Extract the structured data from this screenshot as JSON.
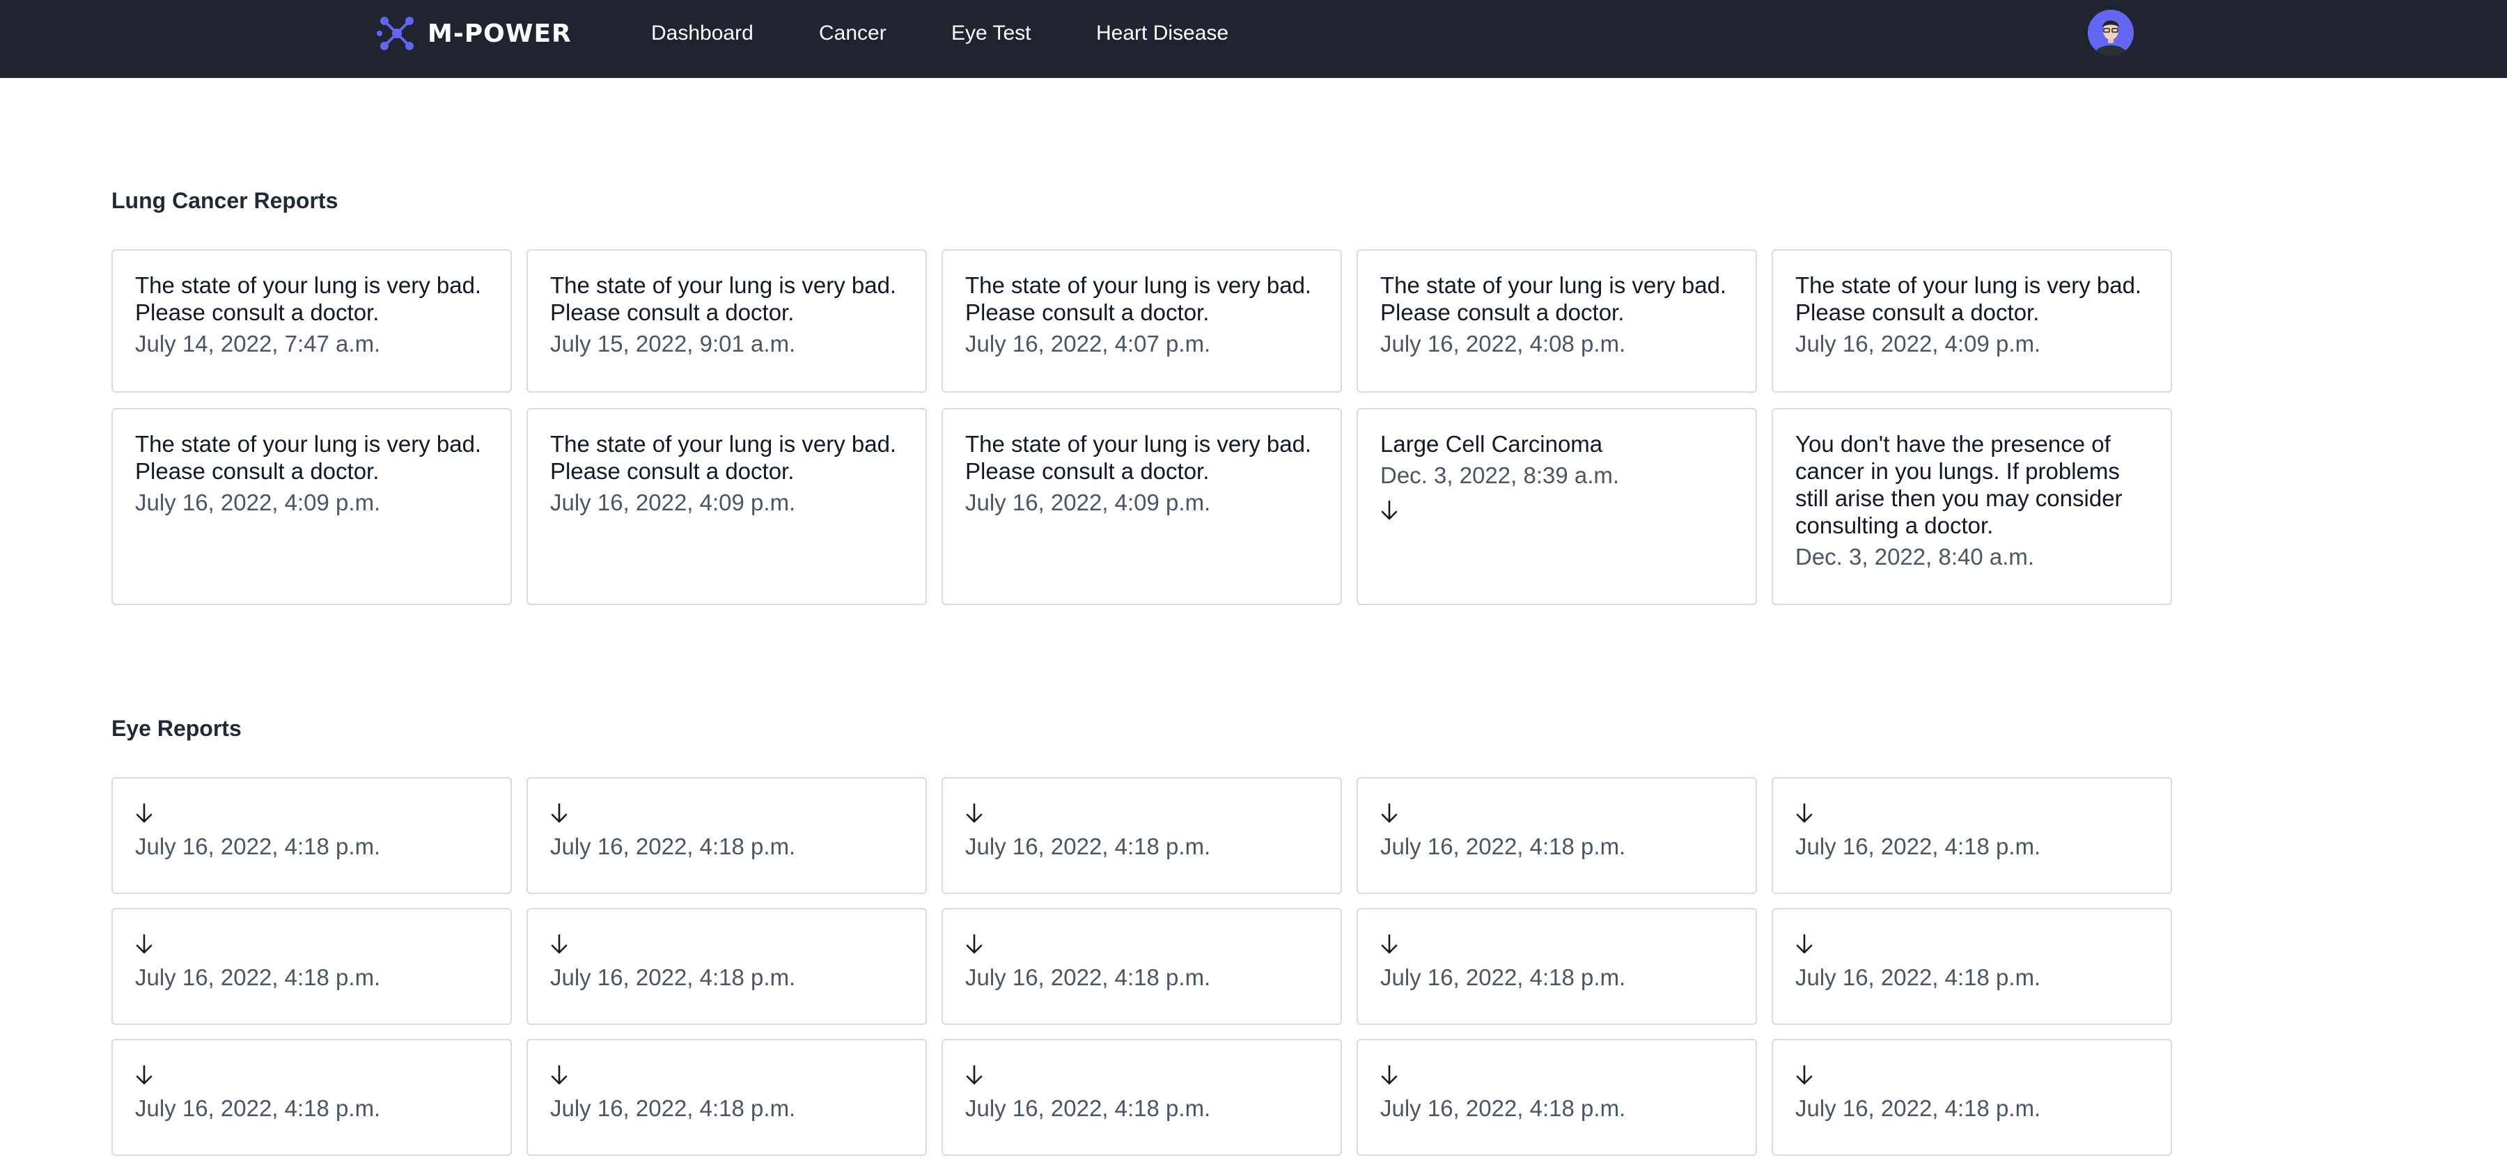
{
  "brand": {
    "name": "M-POWER",
    "logo_icon": "molecule-logo-icon",
    "accent_color": "#6366f1"
  },
  "nav": {
    "items": [
      {
        "label": "Dashboard"
      },
      {
        "label": "Cancer"
      },
      {
        "label": "Eye Test"
      },
      {
        "label": "Heart Disease"
      }
    ],
    "background_color": "#1f2430"
  },
  "user": {
    "avatar_icon": "user-avatar-icon"
  },
  "lung": {
    "title": "Lung Cancer Reports",
    "reports": [
      {
        "result": "The state of your lung is very bad. Please consult a doctor.",
        "date": "July 14, 2022, 7:47 a.m."
      },
      {
        "result": "The state of your lung is very bad. Please consult a doctor.",
        "date": "July 15, 2022, 9:01 a.m."
      },
      {
        "result": "The state of your lung is very bad. Please consult a doctor.",
        "date": "July 16, 2022, 4:07 p.m."
      },
      {
        "result": "The state of your lung is very bad. Please consult a doctor.",
        "date": "July 16, 2022, 4:08 p.m."
      },
      {
        "result": "The state of your lung is very bad. Please consult a doctor.",
        "date": "July 16, 2022, 4:09 p.m."
      },
      {
        "result": "The state of your lung is very bad. Please consult a doctor.",
        "date": "July 16, 2022, 4:09 p.m."
      },
      {
        "result": "The state of your lung is very bad. Please consult a doctor.",
        "date": "July 16, 2022, 4:09 p.m."
      },
      {
        "result": "The state of your lung is very bad. Please consult a doctor.",
        "date": "July 16, 2022, 4:09 p.m."
      },
      {
        "result": "Large Cell Carcinoma",
        "date": "Dec. 3, 2022, 8:39 a.m.",
        "download_icon": "arrow-down-icon"
      },
      {
        "result": "You don't have the presence of cancer in you lungs. If problems still arise then you may consider consulting a doctor.",
        "date": "Dec. 3, 2022, 8:40 a.m."
      }
    ]
  },
  "eye": {
    "title": "Eye Reports",
    "download_icon": "arrow-down-icon",
    "reports": [
      {
        "date": "July 16, 2022, 4:18 p.m."
      },
      {
        "date": "July 16, 2022, 4:18 p.m."
      },
      {
        "date": "July 16, 2022, 4:18 p.m."
      },
      {
        "date": "July 16, 2022, 4:18 p.m."
      },
      {
        "date": "July 16, 2022, 4:18 p.m."
      },
      {
        "date": "July 16, 2022, 4:18 p.m."
      },
      {
        "date": "July 16, 2022, 4:18 p.m."
      },
      {
        "date": "July 16, 2022, 4:18 p.m."
      },
      {
        "date": "July 16, 2022, 4:18 p.m."
      },
      {
        "date": "July 16, 2022, 4:18 p.m."
      },
      {
        "date": "July 16, 2022, 4:18 p.m."
      },
      {
        "date": "July 16, 2022, 4:18 p.m."
      },
      {
        "date": "July 16, 2022, 4:18 p.m."
      },
      {
        "date": "July 16, 2022, 4:18 p.m."
      },
      {
        "date": "July 16, 2022, 4:18 p.m."
      }
    ]
  }
}
